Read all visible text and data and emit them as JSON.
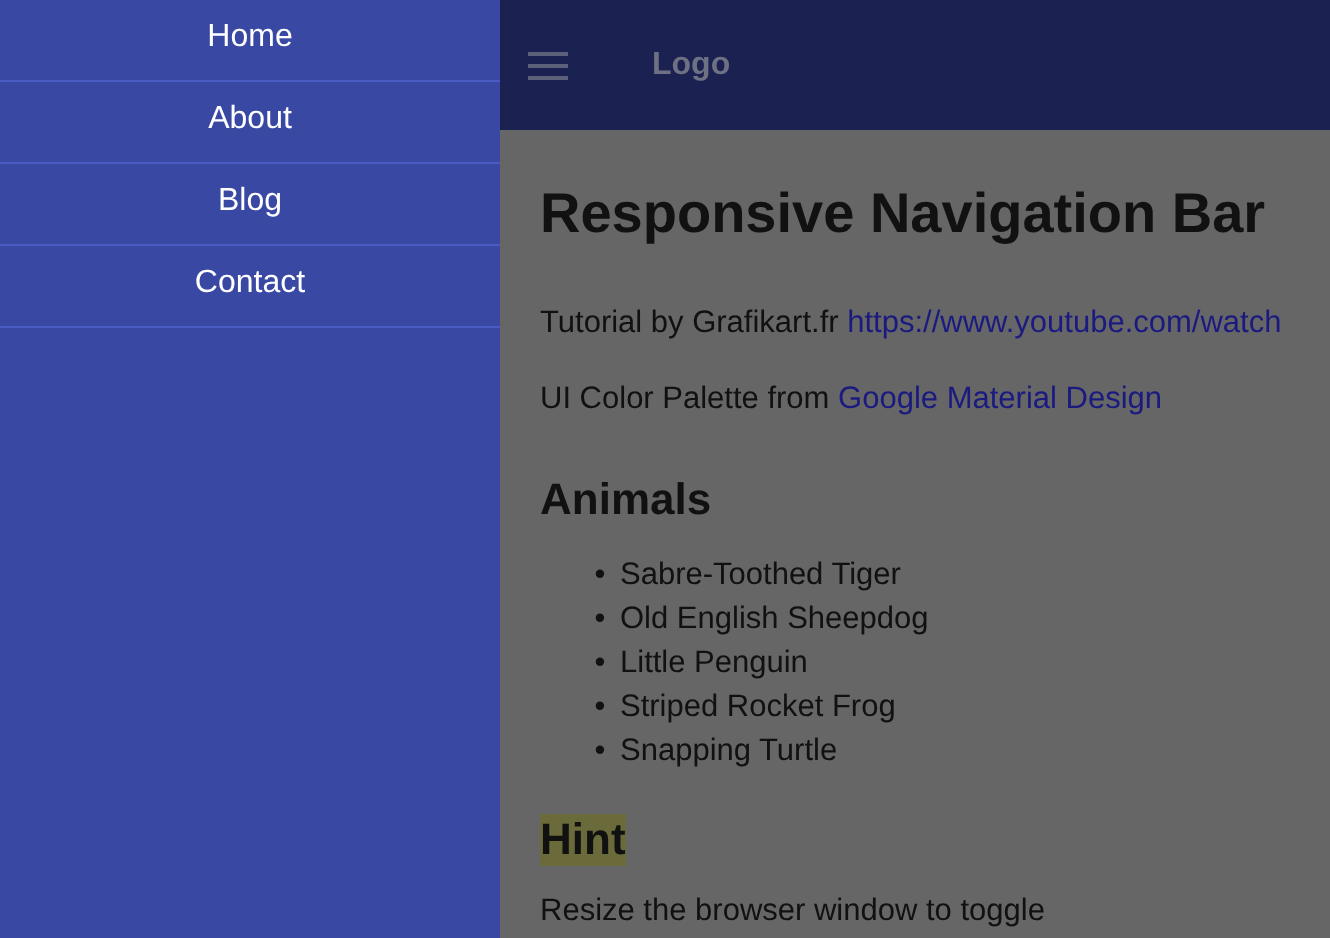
{
  "sidebar": {
    "items": [
      "Home",
      "About",
      "Blog",
      "Contact"
    ]
  },
  "header": {
    "logo": "Logo"
  },
  "content": {
    "title": "Responsive Navigation Bar",
    "paragraphs": [
      {
        "text": "Tutorial by Grafikart.fr",
        "link": "https://www.youtube.com/watch"
      },
      {
        "text": "UI Color Palette from",
        "link": "Google Material Design"
      }
    ],
    "section_heading": "Animals",
    "animals": [
      {
        "marker": "•",
        "text": "Sabre-Toothed Tiger"
      },
      {
        "marker": "•",
        "text": "Old English Sheepdog"
      },
      {
        "marker": "•",
        "text": "Little Penguin"
      },
      {
        "marker": "•",
        "text": "Striped Rocket Frog"
      },
      {
        "marker": "•",
        "text": "Snapping Turtle"
      }
    ],
    "hint_heading": "Hint",
    "hint_text": "Resize the browser window to toggle"
  }
}
